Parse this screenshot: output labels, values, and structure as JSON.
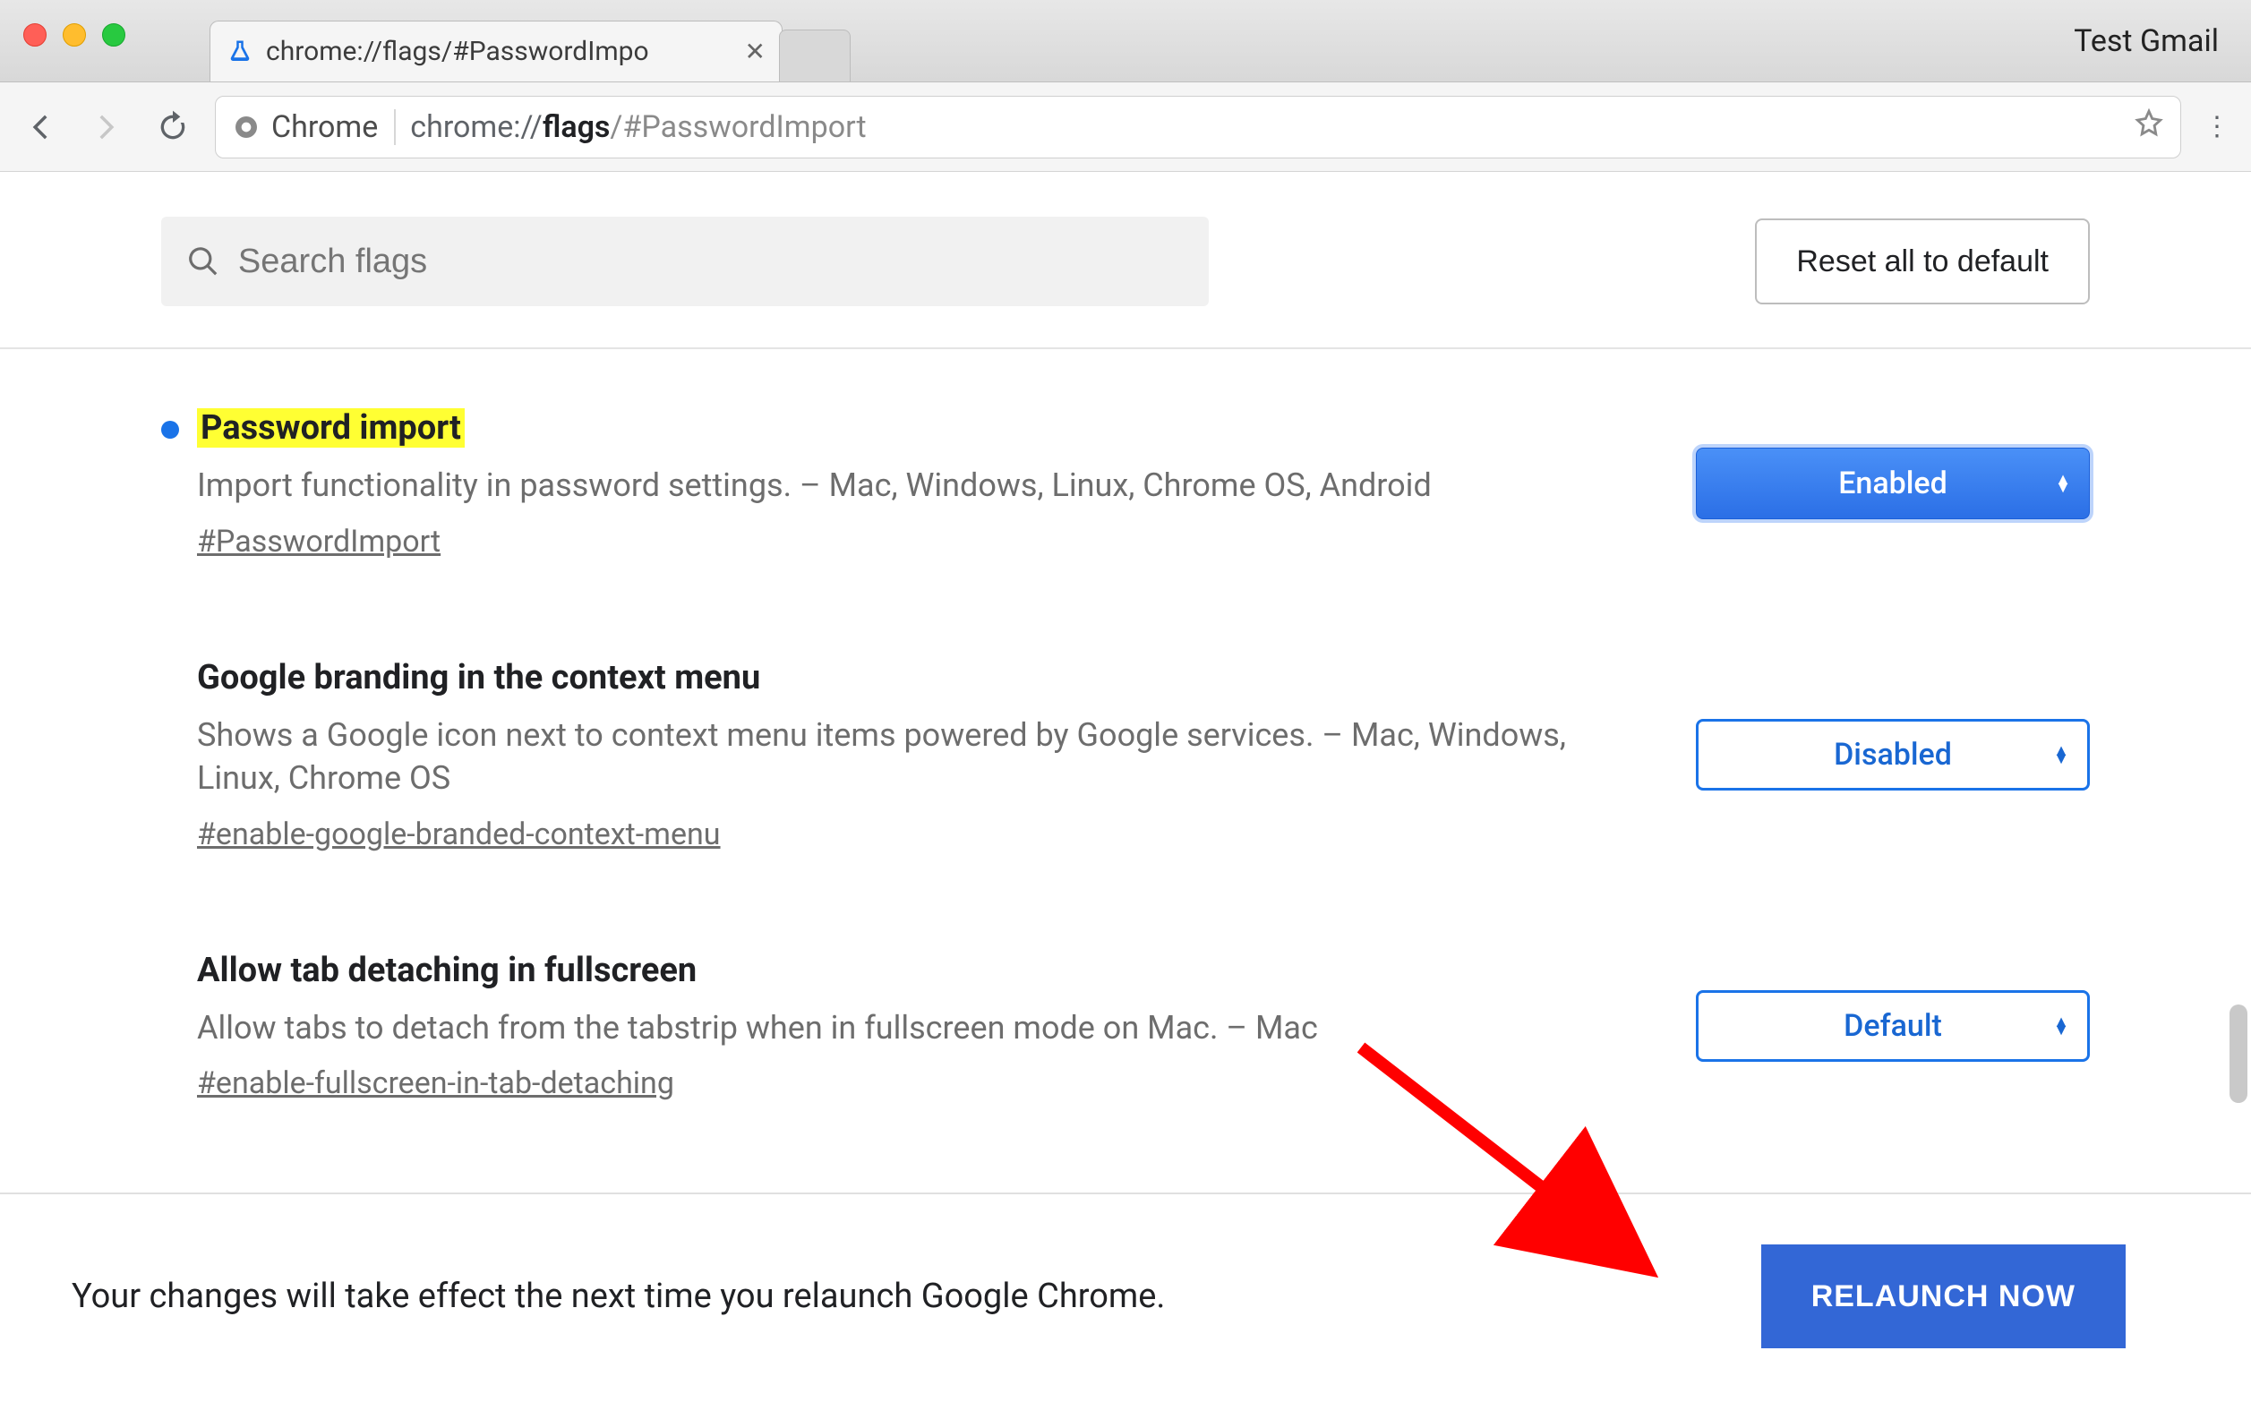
{
  "window": {
    "profile_label": "Test Gmail",
    "tab_title": "chrome://flags/#PasswordImpo"
  },
  "omnibox": {
    "chip_label": "Chrome",
    "url_scheme": "chrome://",
    "url_host": "flags",
    "url_path": "/#PasswordImport"
  },
  "search": {
    "placeholder": "Search flags",
    "reset_label": "Reset all to default"
  },
  "flags": [
    {
      "title": "Password import",
      "highlighted": true,
      "modified": true,
      "description": "Import functionality in password settings. – Mac, Windows, Linux, Chrome OS, Android",
      "anchor": "#PasswordImport",
      "select_value": "Enabled",
      "select_style": "enabled"
    },
    {
      "title": "Google branding in the context menu",
      "highlighted": false,
      "modified": false,
      "description": "Shows a Google icon next to context menu items powered by Google services. – Mac, Windows, Linux, Chrome OS",
      "anchor": "#enable-google-branded-context-menu",
      "select_value": "Disabled",
      "select_style": "outlined"
    },
    {
      "title": "Allow tab detaching in fullscreen",
      "highlighted": false,
      "modified": false,
      "description": "Allow tabs to detach from the tabstrip when in fullscreen mode on Mac. – Mac",
      "anchor": "#enable-fullscreen-in-tab-detaching",
      "select_value": "Default",
      "select_style": "outlined"
    }
  ],
  "footer": {
    "message": "Your changes will take effect the next time you relaunch Google Chrome.",
    "button_label": "RELAUNCH NOW"
  }
}
